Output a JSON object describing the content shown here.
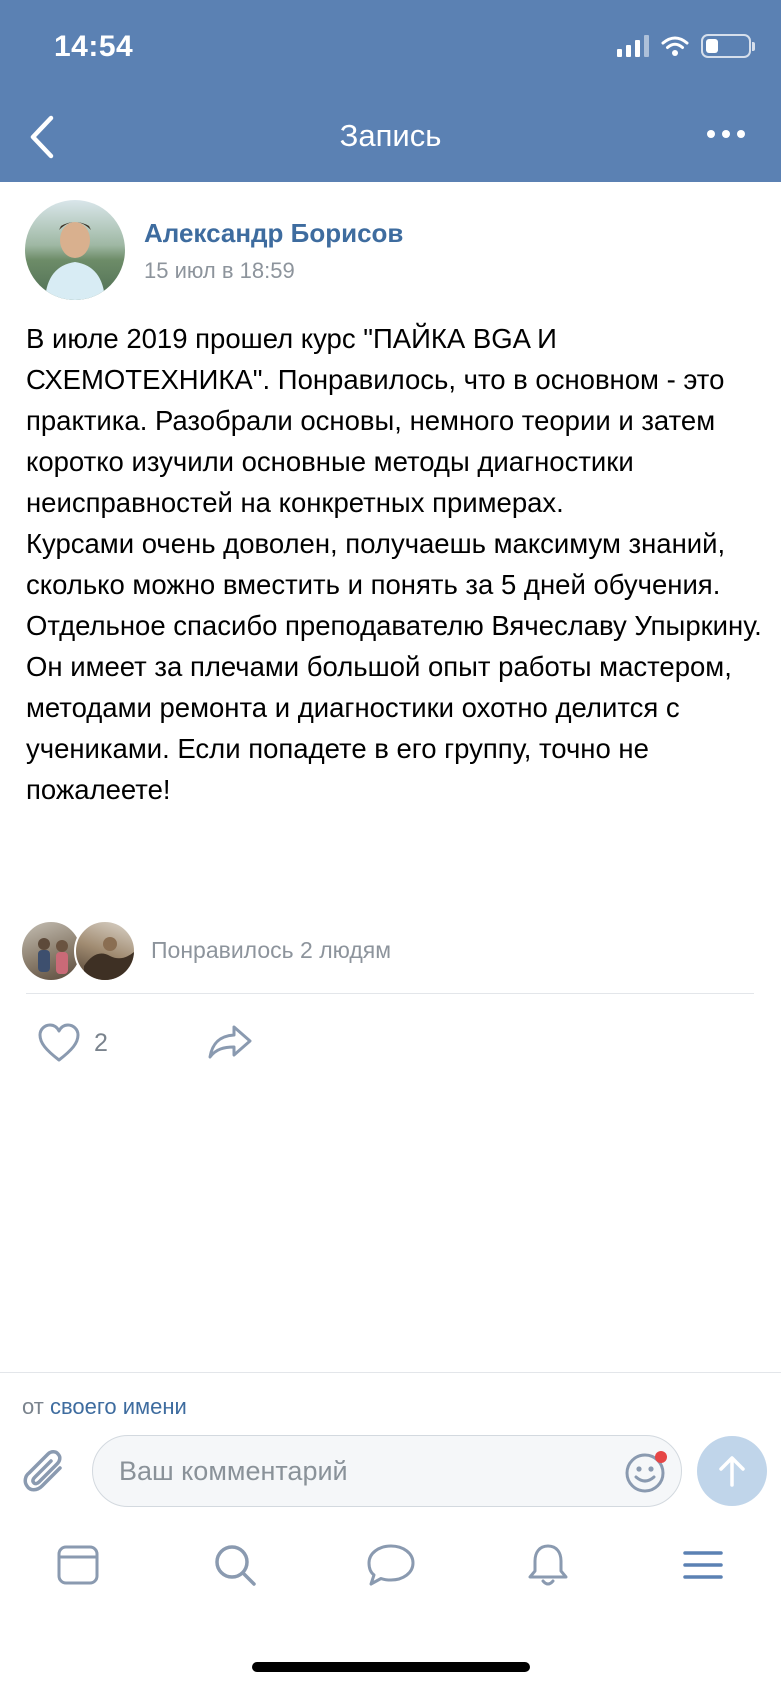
{
  "status_bar": {
    "time": "14:54"
  },
  "nav": {
    "title": "Запись",
    "back_icon": "chevron-left-icon",
    "more_icon": "more-horizontal-icon"
  },
  "post": {
    "author": "Александр Борисов",
    "date": "15 июл в 18:59",
    "paragraphs": [
      "В июле 2019 прошел курс \"ПАЙКА BGA И СХЕМОТЕХНИКА\". Понравилось, что в основном - это практика. Разобрали основы, немного теории и затем коротко изучили основные методы диагностики неисправностей на конкретных примерах.",
      "Курсами очень доволен, получаешь максимум знаний, сколько можно вместить и понять за 5 дней обучения.",
      "Отдельное спасибо преподавателю Вячеславу Упыркину. Он имеет за плечами большой опыт работы мастером, методами ремонта и диагностики охотно делится с учениками. Если попадете в его группу, точно не пожалеете!"
    ],
    "likes_text": "Понравилось 2 людям",
    "like_count": "2"
  },
  "comment": {
    "from_prefix": "от",
    "from_link": "своего имени",
    "placeholder": "Ваш комментарий"
  },
  "tabbar": {
    "items": [
      "news-icon",
      "search-icon",
      "messages-icon",
      "notifications-icon",
      "menu-icon"
    ]
  },
  "colors": {
    "header": "#5b81b3",
    "link": "#3e6c9f",
    "secondary_text": "#8d949c",
    "icon": "#8a9ab0",
    "tab_active": "#5b81b3",
    "send_button": "#c0d5ea"
  }
}
